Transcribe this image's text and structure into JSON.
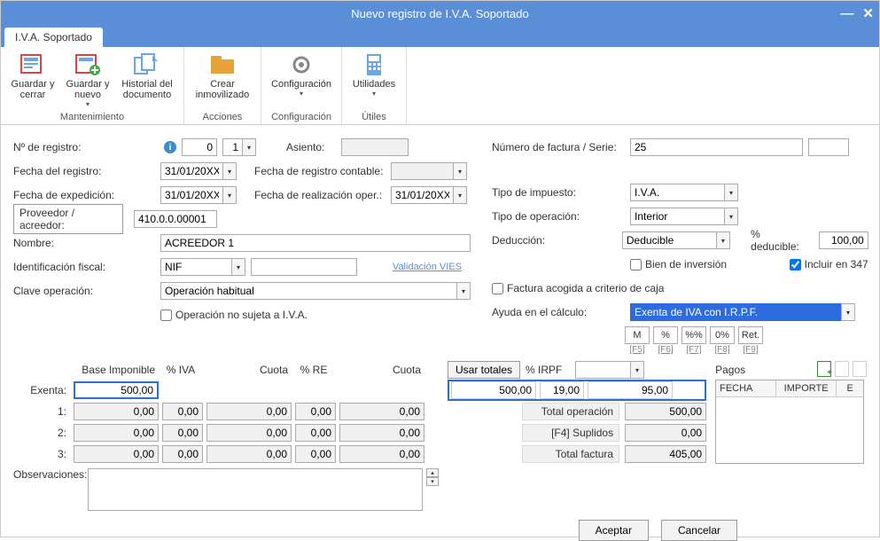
{
  "window": {
    "title": "Nuevo registro de I.V.A. Soportado"
  },
  "tabs": {
    "main": "I.V.A. Soportado"
  },
  "ribbon": {
    "guardar_cerrar": "Guardar y cerrar",
    "guardar_nuevo": "Guardar y nuevo",
    "historial": "Historial del documento",
    "crear_inmov": "Crear inmovilizado",
    "configuracion": "Configuración",
    "utilidades": "Utilidades",
    "grp_mantenimiento": "Mantenimiento",
    "grp_acciones": "Acciones",
    "grp_config": "Configuración",
    "grp_utiles": "Útiles"
  },
  "labels": {
    "nregistro": "Nº de registro:",
    "freg": "Fecha del registro:",
    "fexp": "Fecha de expedición:",
    "prov": "Proveedor / acreedor:",
    "nombre": "Nombre:",
    "idfiscal": "Identificación fiscal:",
    "clave": "Clave operación:",
    "op_no_iva": "Operación no sujeta a I.V.A.",
    "asiento": "Asiento:",
    "freg_cont": "Fecha de registro contable:",
    "freal": "Fecha de realización oper.:",
    "valid_vies": "Validación VIES",
    "nfact": "Número de factura / Serie:",
    "tipo_imp": "Tipo de impuesto:",
    "tipo_op": "Tipo de operación:",
    "deduccion": "Deducción:",
    "pct_ded": "% deducible:",
    "bien_inv": "Bien de inversión",
    "incluir_347": "Incluir en 347",
    "fact_crit_caja": "Factura acogida a criterio de caja",
    "ayuda_calc": "Ayuda en el cálculo:",
    "observ": "Observaciones:",
    "pagos": "Pagos",
    "usar_totales": "Usar totales",
    "pct_irpf": "% IRPF"
  },
  "values": {
    "nreg_a": "0",
    "nreg_b": "1",
    "freg": "31/01/20XX",
    "fexp": "31/01/20XX",
    "freal": "31/01/20XX",
    "prov": "410.0.0.00001",
    "nombre": "ACREEDOR 1",
    "idfiscal_tipo": "NIF",
    "clave": "Operación habitual",
    "nfact": "25",
    "tipo_imp": "I.V.A.",
    "tipo_op": "Interior",
    "deduccion": "Deducible",
    "pct_ded": "100,00",
    "ayuda_sel": "Exenta de IVA con I.R.P.F."
  },
  "mini": {
    "m": "M",
    "pct": "%",
    "pctpct": "%%",
    "zero": "0%",
    "ret": "Ret.",
    "f5": "[F5]",
    "f6": "[F6]",
    "f7": "[F7]",
    "f8": "[F8]",
    "f9": "[F9]"
  },
  "calc": {
    "h_base": "Base Imponible",
    "h_piva": "% IVA",
    "h_cuota": "Cuota",
    "h_pre": "% RE",
    "h_cuota2": "Cuota",
    "r_exenta": "Exenta:",
    "r1": "1:",
    "r2": "2:",
    "r3": "3:",
    "exenta_base": "500,00",
    "zero": "0,00",
    "irpf_base": "500,00",
    "irpf_pct": "19,00",
    "irpf_cuota": "95,00",
    "tot_op_lbl": "Total operación",
    "tot_op": "500,00",
    "supl_lbl": "[F4] Suplidos",
    "supl": "0,00",
    "tot_fac_lbl": "Total factura",
    "tot_fac": "405,00"
  },
  "pagos_cols": {
    "fecha": "FECHA",
    "importe": "IMPORTE",
    "e": "E"
  },
  "buttons": {
    "aceptar": "Aceptar",
    "cancelar": "Cancelar"
  }
}
